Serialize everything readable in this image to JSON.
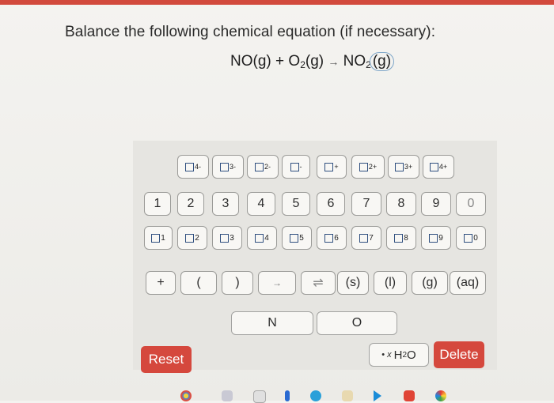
{
  "question": "Balance the following chemical equation (if necessary):",
  "equation": {
    "reactant1": "NO(g)",
    "plus": "+",
    "reactant2_main": "O",
    "reactant2_sub": "2",
    "reactant2_state": "(g)",
    "arrow": "→",
    "product_main": "NO",
    "product_sub": "2",
    "product_state": "(g)"
  },
  "charge_keys": [
    "4-",
    "3-",
    "2-",
    "-",
    "+",
    "2+",
    "3+",
    "4+"
  ],
  "digit_keys": [
    "1",
    "2",
    "3",
    "4",
    "5",
    "6",
    "7",
    "8",
    "9",
    "0"
  ],
  "subscript_keys": [
    "1",
    "2",
    "3",
    "4",
    "5",
    "6",
    "7",
    "8",
    "9",
    "0"
  ],
  "symbol_keys": {
    "plus": "+",
    "paren_open": "(",
    "paren_close": ")",
    "arrow": "→",
    "equilibrium": "⇌",
    "solid": "(s)",
    "liquid": "(l)",
    "gas": "(g)",
    "aqueous": "(aq)"
  },
  "element_keys": [
    "N",
    "O"
  ],
  "water_key": {
    "dot": "•",
    "x": "x",
    "main": "H",
    "sub": "2",
    "tail": "O"
  },
  "buttons": {
    "reset": "Reset",
    "delete": "Delete"
  },
  "colors": {
    "accent": "#d5483d",
    "box_outline": "#2f4f7f",
    "top_bar": "#d24a3d"
  },
  "dock_icons": [
    "chrome-icon",
    "mail-icon",
    "calendar-icon",
    "app-icon",
    "finder-icon",
    "photos-icon",
    "play-icon",
    "video-icon",
    "pinwheel-icon"
  ]
}
